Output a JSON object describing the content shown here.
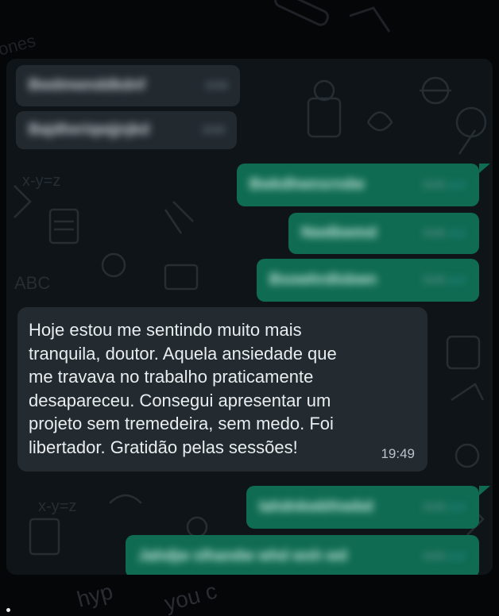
{
  "chat": {
    "blurred_incoming": [
      {
        "text": "Bwdmwnddkdnf",
        "time": "19:46"
      },
      {
        "text": "Bajdheriqwjjnjkd",
        "time": "19:46"
      }
    ],
    "blurred_outgoing_top": [
      {
        "text": "Bwkdhwnsrndw",
        "time": "19:46"
      },
      {
        "text": "Nwdbwmd",
        "time": "19:46"
      },
      {
        "text": "Bsowhrdlsbwn",
        "time": "19:46"
      }
    ],
    "main_message": {
      "text": "Hoje estou me sentindo muito mais\ntranquila, doutor. Aquela ansiedade que\nme travava no trabalho praticamente\ndesapareceu. Consegui apresentar um\nprojeto sem tremedeira, sem medo. Foi\nlibertador. Gratidão pelas sessões!",
      "time": "19:49"
    },
    "blurred_outgoing_bottom": [
      {
        "text": "Iahdnkwbfnwbd",
        "time": "19:49"
      },
      {
        "text": "Jahdjw slhandw whd wsh wd",
        "time": "19:49"
      }
    ]
  },
  "colors": {
    "incoming_bubble": "#232b31",
    "outgoing_bubble": "#0f6b52",
    "chat_background": "#0f1418",
    "read_tick": "#53bdeb"
  },
  "icons": [
    "double-check-icon"
  ]
}
